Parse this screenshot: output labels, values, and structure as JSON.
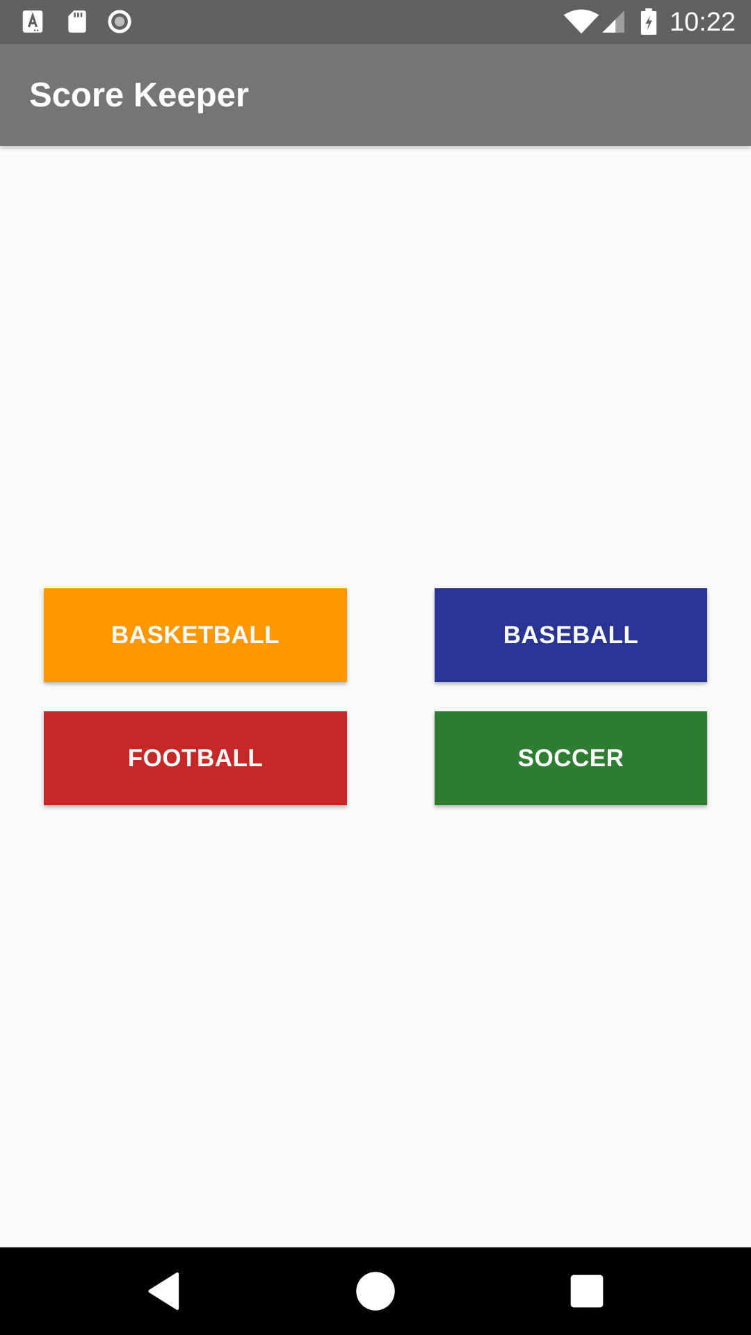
{
  "status_bar": {
    "time": "10:22",
    "icons": [
      "notification-a-icon",
      "sd-card-icon",
      "sync-circle-icon",
      "wifi-icon",
      "cellular-signal-icon",
      "battery-charging-icon"
    ]
  },
  "app_bar": {
    "title": "Score Keeper"
  },
  "sports": {
    "basketball": {
      "label": "BASKETBALL",
      "color": "#ff9800"
    },
    "baseball": {
      "label": "BASEBALL",
      "color": "#283593"
    },
    "football": {
      "label": "FOOTBALL",
      "color": "#c62828"
    },
    "soccer": {
      "label": "SOCCER",
      "color": "#2e7d32"
    }
  },
  "nav_bar": {
    "icons": [
      "back-icon",
      "home-icon",
      "recent-apps-icon"
    ]
  }
}
